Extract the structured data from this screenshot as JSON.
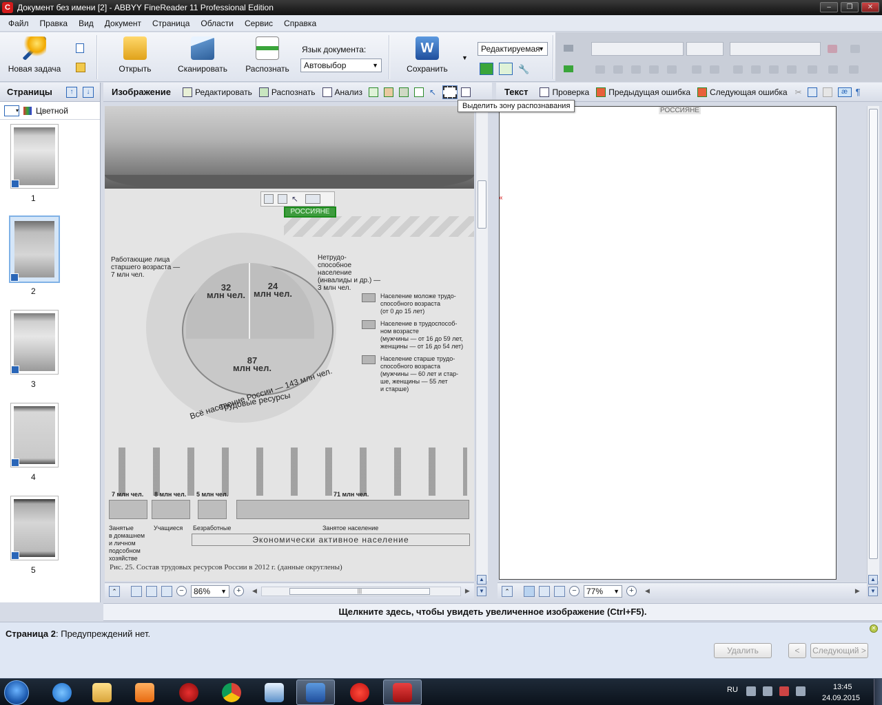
{
  "window": {
    "title": "Документ без имени [2] - ABBYY FineReader 11 Professional Edition",
    "app_icon": "C",
    "controls": [
      "–",
      "❐",
      "✕"
    ]
  },
  "menu": [
    "Файл",
    "Правка",
    "Вид",
    "Документ",
    "Страница",
    "Области",
    "Сервис",
    "Справка"
  ],
  "toolbar": {
    "new_task": "Новая задача",
    "open": "Открыть",
    "scan": "Сканировать",
    "recognize": "Распознать",
    "lang_label": "Язык документа:",
    "lang_value": "Автовыбор",
    "save": "Сохранить",
    "save_mode": "Редактируемая"
  },
  "pages_panel": {
    "title": "Страницы",
    "color_mode": "Цветной",
    "pages": [
      "1",
      "2",
      "3",
      "4",
      "5"
    ],
    "selected_page": "2"
  },
  "image_pane": {
    "title": "Изображение",
    "buttons": [
      "Редактировать",
      "Распознать",
      "Анализ"
    ],
    "tooltip": "Выделить зону распознавания",
    "zoom": "86%",
    "selection_label": "РОССИЯНЕ",
    "scan_text": {
      "label_left": "Работающие лица\nстаршего возраста —\n7 млн чел.",
      "label_right": "Нетрудо-\nспособное\nнаселение\n(инвалиды и др.) —\n3 млн чел.",
      "slice_32": "32\nмлн чел.",
      "slice_24": "24\nмлн чел.",
      "slice_87": "87\nмлн чел.",
      "labor": "Трудовые ресурсы",
      "total": "Всё население России — 143 млн чел.",
      "legend": [
        "Население моложе трудо-\nспособного возраста\n(от 0 до 15 лет)",
        "Население в трудоспособ-\nном возрасте\n(мужчины — от 16 до 59 лет,\nженщины — от 16 до 54 лет)",
        "Население старше трудо-\nспособного возраста\n(мужчины — 60 лет и стар-\nше, женщины — 55 лет\nи старше)"
      ],
      "counts": [
        "7 млн чел.",
        "8 млн чел.",
        "5 млн чел.",
        "71 млн чел."
      ],
      "groups": [
        "Занятые\nв домашнем\nи личном\nподсобном\nхозяйстве",
        "Учащиеся",
        "Безработные",
        "Занятое население"
      ],
      "econ": "Экономически активное население",
      "caption": "Рис. 25. Состав трудовых ресурсов России в 2012 г. (данные округлены)"
    }
  },
  "text_pane": {
    "title": "Текст",
    "buttons": [
      "Проверка",
      "Предыдущая ошибка",
      "Следующая ошибка"
    ],
    "recognized_text": "РОССИЯНЕ",
    "zoom": "77%"
  },
  "zoom_hint": "Щелкните здесь, чтобы увидеть увеличенное изображение (Ctrl+F5).",
  "status": {
    "page_label": "Страница 2",
    "message": ": Предупреждений нет.",
    "delete": "Удалить",
    "prev": "<",
    "next": "Следующий >"
  },
  "taskbar": {
    "lang": "RU",
    "time": "13:45",
    "date": "24.09.2015"
  }
}
